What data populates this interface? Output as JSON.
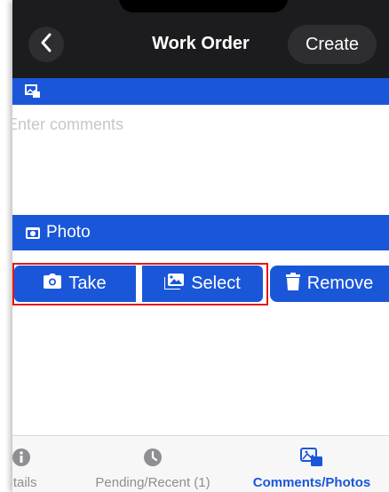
{
  "header": {
    "title": "Work Order",
    "create_label": "Create",
    "back_icon": "chevron-left-icon"
  },
  "comments_section": {
    "icon": "photos-icon",
    "placeholder": "Enter comments",
    "value": ""
  },
  "photo_section": {
    "icon": "camera-icon",
    "label": "Photo",
    "buttons": {
      "take": "Take",
      "select": "Select",
      "remove": "Remove"
    }
  },
  "tabs": [
    {
      "label": "etails",
      "icon": "info-icon",
      "active": false
    },
    {
      "label": "Pending/Recent (1)",
      "icon": "clock-icon",
      "active": false
    },
    {
      "label": "Comments/Photos",
      "icon": "photos-icon",
      "active": true
    }
  ],
  "colors": {
    "header_bg": "#1c1c1e",
    "accent_blue": "#1a57d8",
    "highlight_red": "#e01818",
    "tab_inactive": "#8e8e93"
  }
}
